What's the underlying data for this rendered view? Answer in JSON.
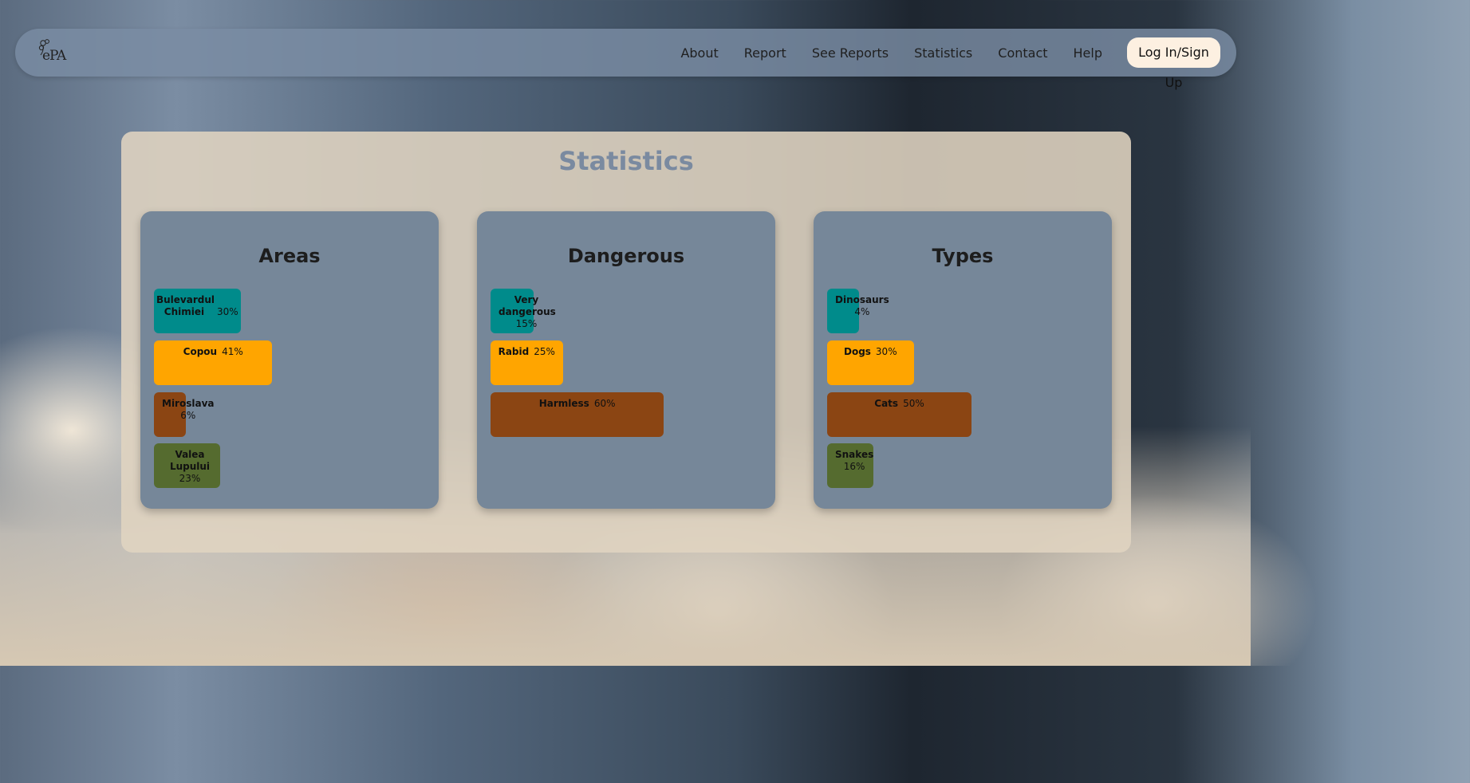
{
  "nav": {
    "logo_text": "ePA",
    "links": [
      "About",
      "Report",
      "See Reports",
      "Statistics",
      "Contact",
      "Help"
    ],
    "login": "Log In/Sign Up"
  },
  "page_title": "Statistics",
  "colors": [
    "#008b8b",
    "#ffa500",
    "#8b4513",
    "#556b2f"
  ],
  "chart_data": [
    {
      "type": "bar",
      "title": "Areas",
      "orientation": "horizontal",
      "categories": [
        "Bulevardul Chimiei",
        "Copou",
        "Miroslava",
        "Valea Lupului"
      ],
      "values": [
        30,
        41,
        6,
        23
      ],
      "labels": [
        "30%",
        "41%",
        "6%",
        "23%"
      ],
      "unit": "%"
    },
    {
      "type": "bar",
      "title": "Dangerous",
      "orientation": "horizontal",
      "categories": [
        "Very dangerous",
        "Rabid",
        "Harmless"
      ],
      "values": [
        15,
        25,
        60
      ],
      "labels": [
        "15%",
        "25%",
        "60%"
      ],
      "unit": "%"
    },
    {
      "type": "bar",
      "title": "Types",
      "orientation": "horizontal",
      "categories": [
        "Dinosaurs",
        "Dogs",
        "Cats",
        "Snakes"
      ],
      "values": [
        4,
        30,
        50,
        16
      ],
      "labels": [
        "4%",
        "30%",
        "50%",
        "16%"
      ],
      "unit": "%"
    }
  ]
}
